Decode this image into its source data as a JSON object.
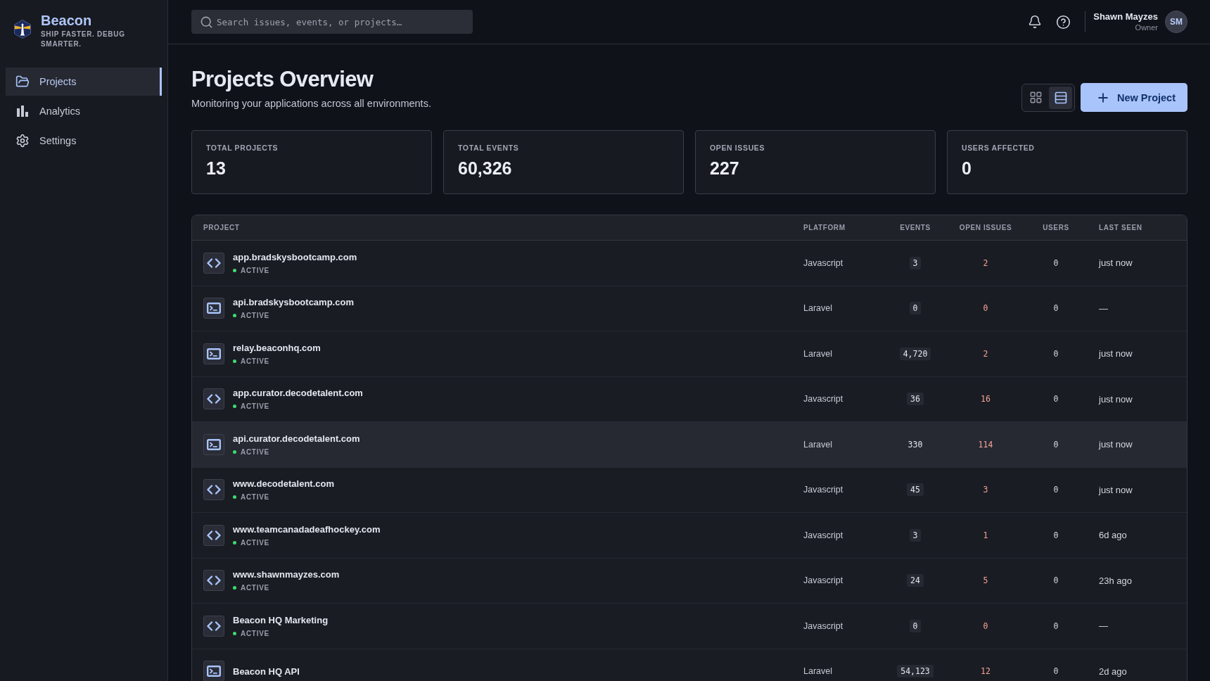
{
  "sidebar": {
    "brand": {
      "name": "Beacon",
      "tagline": "SHIP FASTER. DEBUG SMARTER."
    },
    "nav": [
      {
        "label": "Projects",
        "selected": true
      },
      {
        "label": "Analytics",
        "selected": false
      },
      {
        "label": "Settings",
        "selected": false
      }
    ]
  },
  "topbar": {
    "search": {
      "placeholder": "Search issues, events, or projects…"
    },
    "user": {
      "name": "Shawn Mayzes",
      "role": "Owner",
      "initials": "SM"
    }
  },
  "header": {
    "title": "Projects Overview",
    "subtitle": "Monitoring your applications across all environments.",
    "view_toggle": [
      {
        "kind": "grid",
        "selected": false
      },
      {
        "kind": "list",
        "selected": true
      }
    ],
    "new_button": "New Project"
  },
  "stats": [
    {
      "label": "TOTAL PROJECTS",
      "value": "13"
    },
    {
      "label": "TOTAL EVENTS",
      "value": "60,326"
    },
    {
      "label": "OPEN ISSUES",
      "value": "227"
    },
    {
      "label": "USERS AFFECTED",
      "value": "0"
    }
  ],
  "projects": {
    "columns": [
      "PROJECT",
      "PLATFORM",
      "EVENTS",
      "OPEN ISSUES",
      "USERS",
      "LAST SEEN"
    ],
    "rows": [
      {
        "kind": "code",
        "name": "app.bradskysbootcamp.com",
        "status": "ACTIVE",
        "active": true,
        "platform": "Javascript",
        "events": "3",
        "open_issues": "2",
        "users": "0",
        "last_seen": "just now",
        "highlighted": false
      },
      {
        "kind": "terminal",
        "name": "api.bradskysbootcamp.com",
        "status": "ACTIVE",
        "active": true,
        "platform": "Laravel",
        "events": "0",
        "open_issues": "0",
        "users": "0",
        "last_seen": "—",
        "highlighted": false
      },
      {
        "kind": "terminal",
        "name": "relay.beaconhq.com",
        "status": "ACTIVE",
        "active": true,
        "platform": "Laravel",
        "events": "4,720",
        "open_issues": "2",
        "users": "0",
        "last_seen": "just now",
        "highlighted": false
      },
      {
        "kind": "code",
        "name": "app.curator.decodetalent.com",
        "status": "ACTIVE",
        "active": true,
        "platform": "Javascript",
        "events": "36",
        "open_issues": "16",
        "users": "0",
        "last_seen": "just now",
        "highlighted": false
      },
      {
        "kind": "terminal",
        "name": "api.curator.decodetalent.com",
        "status": "ACTIVE",
        "active": true,
        "platform": "Laravel",
        "events": "330",
        "open_issues": "114",
        "users": "0",
        "last_seen": "just now",
        "highlighted": true
      },
      {
        "kind": "code",
        "name": "www.decodetalent.com",
        "status": "ACTIVE",
        "active": true,
        "platform": "Javascript",
        "events": "45",
        "open_issues": "3",
        "users": "0",
        "last_seen": "just now",
        "highlighted": false
      },
      {
        "kind": "code",
        "name": "www.teamcanadadeafhockey.com",
        "status": "ACTIVE",
        "active": true,
        "platform": "Javascript",
        "events": "3",
        "open_issues": "1",
        "users": "0",
        "last_seen": "6d ago",
        "highlighted": false
      },
      {
        "kind": "code",
        "name": "www.shawnmayzes.com",
        "status": "ACTIVE",
        "active": true,
        "platform": "Javascript",
        "events": "24",
        "open_issues": "5",
        "users": "0",
        "last_seen": "23h ago",
        "highlighted": false
      },
      {
        "kind": "code",
        "name": "Beacon HQ Marketing",
        "status": "ACTIVE",
        "active": true,
        "platform": "Javascript",
        "events": "0",
        "open_issues": "0",
        "users": "0",
        "last_seen": "—",
        "highlighted": false
      },
      {
        "kind": "terminal",
        "name": "Beacon HQ API",
        "platform": "Laravel",
        "events": "54,123",
        "open_issues": "12",
        "users": "0",
        "last_seen": "2d ago",
        "highlighted": false
      }
    ]
  }
}
